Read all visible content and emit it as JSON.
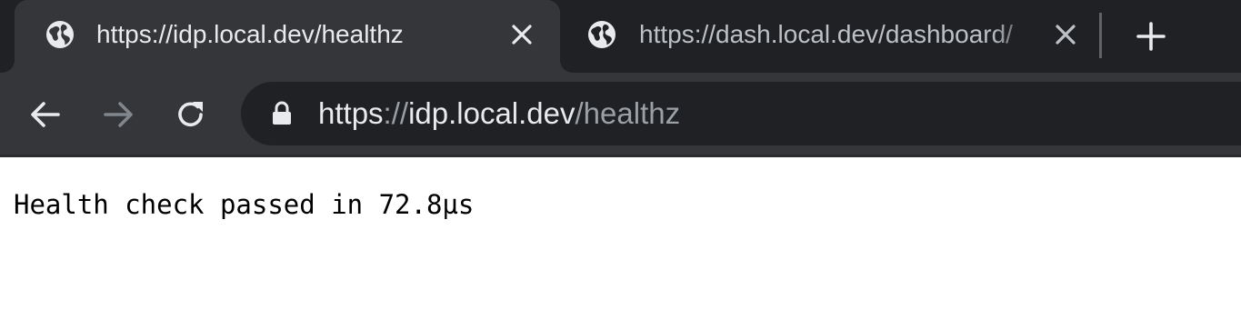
{
  "tabs": [
    {
      "title": "https://idp.local.dev/healthz",
      "active": true,
      "icon": "globe-icon"
    },
    {
      "title": "https://dash.local.dev/dashboard/",
      "active": false,
      "icon": "globe-icon"
    }
  ],
  "new_tab_icon": "plus-icon",
  "toolbar": {
    "back_icon": "arrow-left-icon",
    "forward_icon": "arrow-right-icon",
    "reload_icon": "reload-icon"
  },
  "address_bar": {
    "lock_icon": "lock-icon",
    "scheme": "https",
    "separator": "://",
    "host": "idp.local.dev",
    "path": "/healthz"
  },
  "page": {
    "body_text": "Health check passed in 72.8µs"
  },
  "colors": {
    "tab_strip": "#202124",
    "active_tab": "#35363a",
    "omnibox": "#202124",
    "text_primary": "#e8eaed",
    "text_secondary": "#9aa0a6"
  }
}
